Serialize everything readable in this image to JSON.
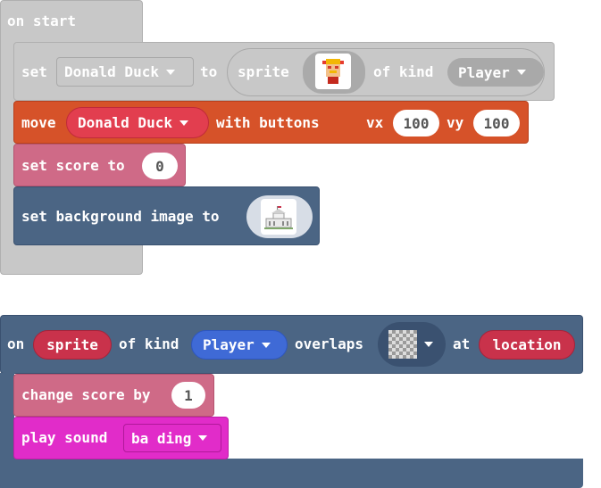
{
  "colors": {
    "event_gray": "#c8c8c8",
    "sprite_blue_gray": "#4b6584",
    "move_orange": "#d65229",
    "move_red_pill": "#e23e4f",
    "score_pink": "#cf6a87",
    "sound_magenta": "#e12cc9",
    "player_blue": "#3f6ad6",
    "sprite_red": "#c9324b"
  },
  "on_start": {
    "hat_label": "on start",
    "set_sprite": {
      "set_label": "set",
      "variable": "Donald Duck",
      "to_label": "to",
      "sprite_label": "sprite",
      "image_icon": "donald-duck-pixel-icon",
      "of_kind_label": "of kind",
      "kind": "Player"
    },
    "move": {
      "move_label": "move",
      "sprite": "Donald Duck",
      "with_buttons_label": "with buttons",
      "vx_label": "vx",
      "vx": "100",
      "vy_label": "vy",
      "vy": "100"
    },
    "set_score": {
      "label": "set score to",
      "value": "0"
    },
    "set_background": {
      "label": "set background image to",
      "image_icon": "white-house-thumbnail-icon"
    }
  },
  "on_overlap": {
    "on_label": "on",
    "sprite_var": "sprite",
    "of_kind_label": "of kind",
    "kind": "Player",
    "overlaps_label": "overlaps",
    "other_kind_icon": "checkerboard-transparent-icon",
    "at_label": "at",
    "location_var": "location",
    "change_score": {
      "label": "change score by",
      "value": "1"
    },
    "play_sound": {
      "label": "play sound",
      "sound": "ba ding"
    }
  }
}
